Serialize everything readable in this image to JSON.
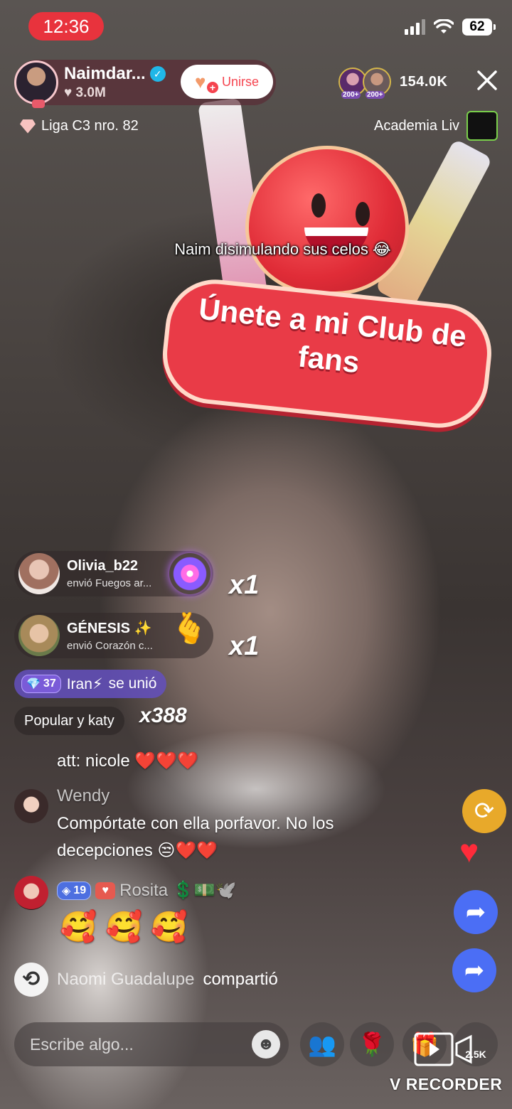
{
  "status_bar": {
    "time": "12:36",
    "battery": "62"
  },
  "host": {
    "name": "Naimdar...",
    "likes": "♥ 3.0M",
    "join_label": "Unirse"
  },
  "viewers": {
    "badge_1": "200+",
    "badge_2": "200+",
    "count": "154.0K"
  },
  "league": {
    "label": "Liga C3 nro. 82"
  },
  "academy": {
    "label": "Academia Liv"
  },
  "banner": {
    "text": "Únete a mi Club de fans"
  },
  "caption": {
    "text": "Naim disimulando sus celos 😂"
  },
  "gifts": [
    {
      "name": "Olivia_b22",
      "action": "envió Fuegos ar...",
      "count": "x1"
    },
    {
      "name": "GÉNESIS ✨",
      "action": "envió Corazón c...",
      "count": "x1"
    }
  ],
  "join_event": {
    "level": "37",
    "user": "Iran⚡",
    "action": "se unió"
  },
  "popular": {
    "label": "Popular y katy",
    "count": "x388"
  },
  "chat": [
    {
      "text": "att: nicole ❤️❤️❤️"
    },
    {
      "name": "Wendy",
      "text": "Compórtate con ella porfavor.  No los decepciones 😒❤️❤️"
    },
    {
      "badge_level": "19",
      "name": "Rosita 💲💵🕊️",
      "text": "🥰 🥰 🥰"
    }
  ],
  "share_event": {
    "user": "Naomi Guadalupe",
    "action": "compartió"
  },
  "input": {
    "placeholder": "Escribe algo..."
  },
  "bottom": {
    "count": "2.5K",
    "recorder": "V RECORDER"
  },
  "colors": {
    "accent_red": "#e8333d",
    "share_blue": "#4b6ef5",
    "repost_gold": "#e8a92a"
  }
}
